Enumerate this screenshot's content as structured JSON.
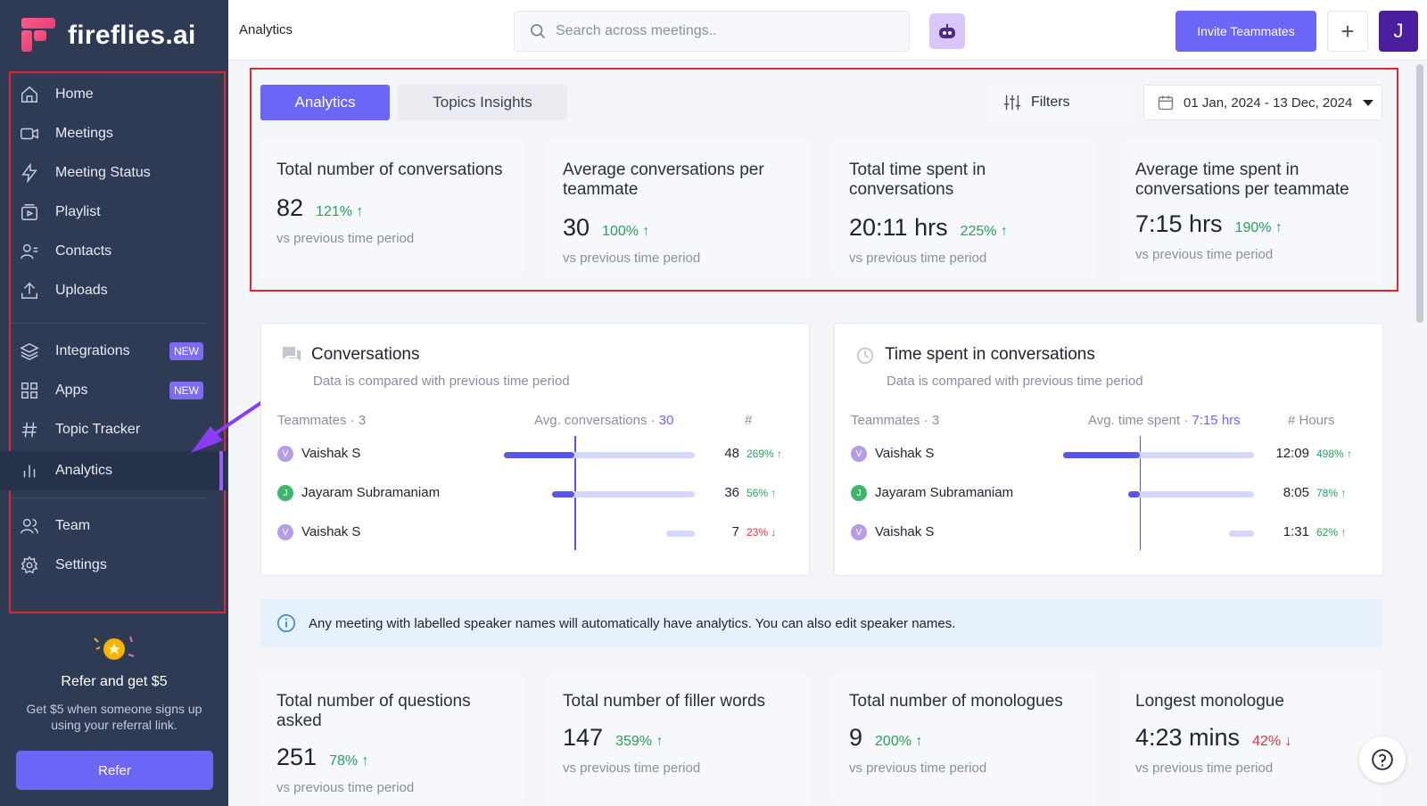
{
  "app": {
    "logo_text": "fireflies.ai"
  },
  "sidebar": {
    "items": [
      {
        "label": "Home",
        "icon": "home-icon"
      },
      {
        "label": "Meetings",
        "icon": "video-icon"
      },
      {
        "label": "Meeting Status",
        "icon": "bolt-icon"
      },
      {
        "label": "Playlist",
        "icon": "playlist-icon"
      },
      {
        "label": "Contacts",
        "icon": "contacts-icon"
      },
      {
        "label": "Uploads",
        "icon": "upload-icon"
      },
      {
        "label": "Integrations",
        "icon": "layers-icon",
        "badge": "NEW"
      },
      {
        "label": "Apps",
        "icon": "grid-icon",
        "badge": "NEW"
      },
      {
        "label": "Topic Tracker",
        "icon": "hash-icon"
      },
      {
        "label": "Analytics",
        "icon": "chart-icon",
        "active": true
      },
      {
        "label": "Team",
        "icon": "team-icon"
      },
      {
        "label": "Settings",
        "icon": "gear-icon"
      }
    ],
    "refer": {
      "title": "Refer and get $5",
      "subtitle": "Get $5 when someone signs up using your referral link.",
      "button": "Refer"
    }
  },
  "topbar": {
    "title": "Analytics",
    "search_placeholder": "Search across meetings..",
    "invite_label": "Invite Teammates",
    "plus_label": "+",
    "avatar_initial": "J"
  },
  "tabs": [
    {
      "label": "Analytics",
      "active": true
    },
    {
      "label": "Topics Insights",
      "active": false
    }
  ],
  "filters_label": "Filters",
  "date_range": "01 Jan, 2024 - 13 Dec, 2024",
  "stats_top": [
    {
      "label": "Total number of conversations",
      "value": "82",
      "delta": "121%",
      "dir": "up",
      "sub": "vs previous time period"
    },
    {
      "label": "Average conversations per teammate",
      "value": "30",
      "delta": "100%",
      "dir": "up",
      "sub": "vs previous time period"
    },
    {
      "label": "Total time spent in conversations",
      "value": "20:11 hrs",
      "delta": "225%",
      "dir": "up",
      "sub": "vs previous time period"
    },
    {
      "label": "Average time spent in conversations per teammate",
      "value": "7:15 hrs",
      "delta": "190%",
      "dir": "up",
      "sub": "vs previous time period"
    }
  ],
  "conversations_panel": {
    "title": "Conversations",
    "subtitle": "Data is compared with previous time period",
    "col_teammates": "Teammates · 3",
    "col_avg_label": "Avg. conversations · ",
    "col_avg_value": "30",
    "col_count": "#",
    "avg_fraction": 0.37,
    "rows": [
      {
        "initial": "V",
        "name": "Vaishak S",
        "color": "#b79ce6",
        "value": "48",
        "delta": "269%",
        "dir": "up",
        "fill": 0.37,
        "track_start": 0.0
      },
      {
        "initial": "J",
        "name": "Jayaram Subramaniam",
        "color": "#3fb56b",
        "value": "36",
        "delta": "56%",
        "dir": "up",
        "fill": 0.12,
        "track_start": 0.25
      },
      {
        "initial": "V",
        "name": "Vaishak S",
        "color": "#b79ce6",
        "value": "7",
        "delta": "23%",
        "dir": "down",
        "fill": 0.0,
        "track_start": 0.85
      }
    ]
  },
  "time_panel": {
    "title": "Time spent in conversations",
    "subtitle": "Data is compared with previous time period",
    "col_teammates": "Teammates · 3",
    "col_avg_label": "Avg. time spent · ",
    "col_avg_value": "7:15 hrs",
    "col_count": "# Hours",
    "avg_fraction": 0.4,
    "rows": [
      {
        "initial": "V",
        "name": "Vaishak S",
        "color": "#b79ce6",
        "value": "12:09",
        "delta": "498%",
        "dir": "up",
        "fill": 0.4,
        "track_start": 0.0
      },
      {
        "initial": "J",
        "name": "Jayaram Subramaniam",
        "color": "#3fb56b",
        "value": "8:05",
        "delta": "78%",
        "dir": "up",
        "fill": 0.06,
        "track_start": 0.34
      },
      {
        "initial": "V",
        "name": "Vaishak S",
        "color": "#b79ce6",
        "value": "1:31",
        "delta": "62%",
        "dir": "up",
        "fill": 0.0,
        "track_start": 0.87
      }
    ]
  },
  "info_banner": "Any meeting with labelled speaker names will automatically have analytics. You can also edit speaker names.",
  "stats_bottom": [
    {
      "label": "Total number of questions asked",
      "value": "251",
      "delta": "78%",
      "dir": "up",
      "sub": "vs previous time period"
    },
    {
      "label": "Total number of filler words",
      "value": "147",
      "delta": "359%",
      "dir": "up",
      "sub": "vs previous time period"
    },
    {
      "label": "Total number of monologues",
      "value": "9",
      "delta": "200%",
      "dir": "up",
      "sub": "vs previous time period"
    },
    {
      "label": "Longest monologue",
      "value": "4:23 mins",
      "delta": "42%",
      "dir": "down",
      "sub": "vs previous time period"
    }
  ],
  "colors": {
    "accent": "#6c66f6",
    "sidebar": "#2f3b55",
    "up": "#23a35b",
    "down": "#e0363f",
    "highlight": "#e0262e"
  }
}
